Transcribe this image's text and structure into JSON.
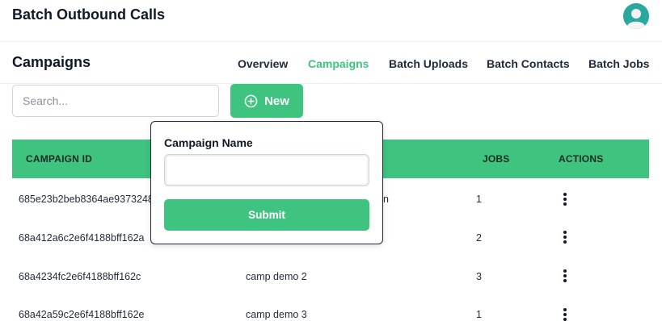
{
  "app": {
    "title": "Batch Outbound Calls"
  },
  "header": {
    "page_title": "Campaigns"
  },
  "nav": [
    {
      "label": "Overview",
      "active": false
    },
    {
      "label": "Campaigns",
      "active": true
    },
    {
      "label": "Batch Uploads",
      "active": false
    },
    {
      "label": "Batch Contacts",
      "active": false
    },
    {
      "label": "Batch Jobs",
      "active": false
    }
  ],
  "search": {
    "placeholder": "Search...",
    "value": ""
  },
  "new_button": {
    "label": "New",
    "icon": "plus-circle-icon"
  },
  "table": {
    "columns": [
      "CAMPAIGN ID",
      "JOBS",
      "ACTIONS"
    ],
    "rows": [
      {
        "id": "685e23b2beb8364ae9373248",
        "name": "",
        "name_tail": "n",
        "jobs": "1"
      },
      {
        "id": "68a412a6c2e6f4188bff162a",
        "name": "",
        "name_tail": "",
        "jobs": "2"
      },
      {
        "id": "68a4234fc2e6f4188bff162c",
        "name": "camp demo 2",
        "name_tail": "",
        "jobs": "3"
      },
      {
        "id": "68a42a59c2e6f4188bff162e",
        "name": "camp demo 3",
        "name_tail": "",
        "jobs": "1"
      }
    ]
  },
  "popover": {
    "label": "Campaign Name",
    "value": "",
    "submit_label": "Submit"
  },
  "colors": {
    "accent": "#3ec47e",
    "avatar_bg": "#2aa8a0"
  }
}
